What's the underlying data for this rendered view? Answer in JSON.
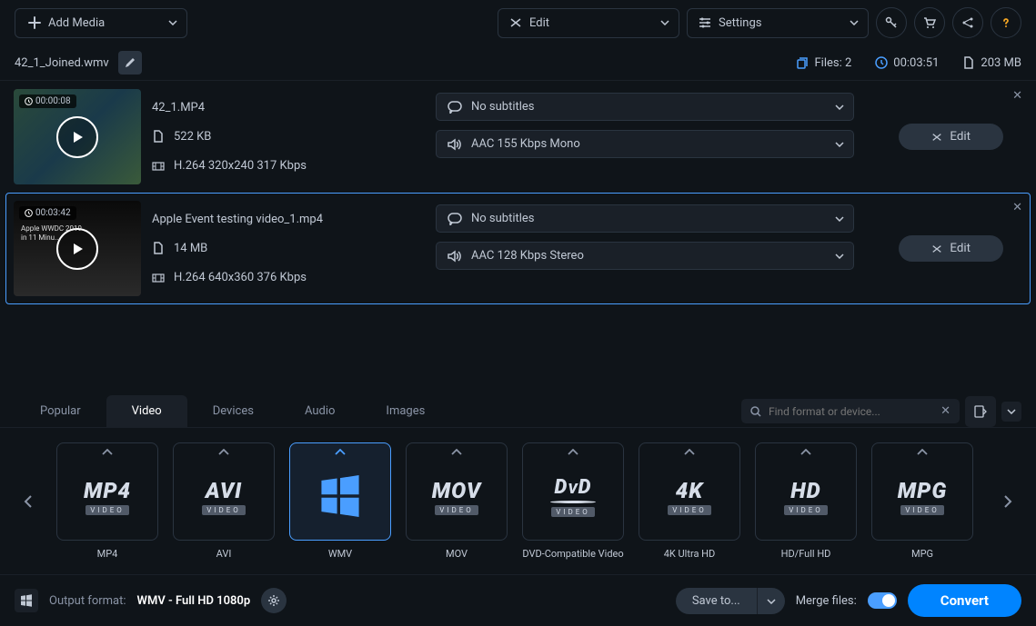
{
  "toolbar": {
    "add_media": "Add Media",
    "edit": "Edit",
    "settings": "Settings"
  },
  "project": {
    "name": "42_1_Joined.wmv"
  },
  "status": {
    "files_label": "Files: 2",
    "duration": "00:03:51",
    "size": "203 MB"
  },
  "files": [
    {
      "duration": "00:00:08",
      "name": "42_1.MP4",
      "size": "522 KB",
      "codec": "H.264 320x240 317 Kbps",
      "subtitle": "No subtitles",
      "audio": "AAC 155 Kbps Mono",
      "edit_label": "Edit",
      "selected": false
    },
    {
      "duration": "00:03:42",
      "name": "Apple Event testing video_1.mp4",
      "size": "14 MB",
      "codec": "H.264 640x360 376 Kbps",
      "subtitle": "No subtitles",
      "audio": "AAC 128 Kbps Stereo",
      "edit_label": "Edit",
      "selected": true
    }
  ],
  "formats": {
    "tabs": [
      "Popular",
      "Video",
      "Devices",
      "Audio",
      "Images"
    ],
    "active_tab": "Video",
    "search_placeholder": "Find format or device...",
    "cards": [
      {
        "logo": "MP4",
        "sub": "VIDEO",
        "label": "MP4"
      },
      {
        "logo": "AVI",
        "sub": "VIDEO",
        "label": "AVI"
      },
      {
        "logo": "WIN",
        "sub": "",
        "label": "WMV",
        "active": true
      },
      {
        "logo": "MOV",
        "sub": "VIDEO",
        "label": "MOV"
      },
      {
        "logo": "DVD",
        "sub": "VIDEO",
        "label": "DVD-Compatible Video"
      },
      {
        "logo": "4K",
        "sub": "VIDEO",
        "label": "4K Ultra HD"
      },
      {
        "logo": "HD",
        "sub": "VIDEO",
        "label": "HD/Full HD"
      },
      {
        "logo": "MPG",
        "sub": "VIDEO",
        "label": "MPG"
      }
    ]
  },
  "output": {
    "label": "Output format:",
    "value": "WMV - Full HD 1080p"
  },
  "bottom": {
    "save_to": "Save to...",
    "merge": "Merge files:",
    "convert": "Convert"
  }
}
